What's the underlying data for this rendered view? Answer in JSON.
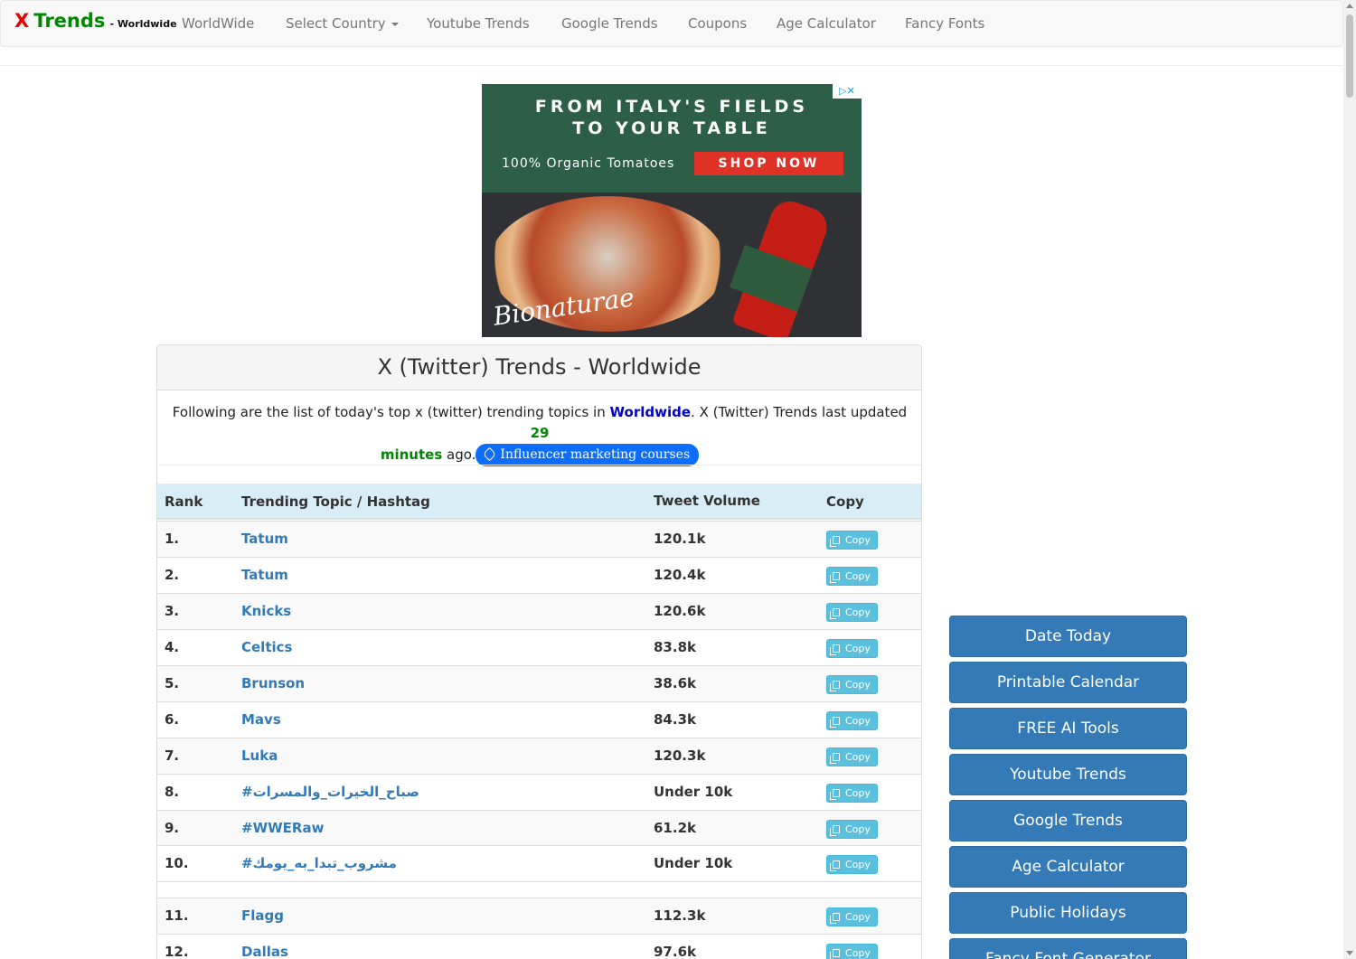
{
  "brand": {
    "x": "X",
    "trends": "Trends",
    "suffix": "- Worldwide"
  },
  "nav": {
    "worldwide": "WorldWide",
    "select_country": "Select Country",
    "youtube_trends": "Youtube Trends",
    "google_trends": "Google Trends",
    "coupons": "Coupons",
    "age_calculator": "Age Calculator",
    "fancy_fonts": "Fancy Fonts"
  },
  "ad": {
    "headline_1": "FROM ITALY'S FIELDS",
    "headline_2": "TO YOUR TABLE",
    "subline": "100% Organic Tomatoes",
    "cta": "SHOP NOW",
    "brand": "Bionaturae"
  },
  "panel": {
    "title": "X (Twitter) Trends - Worldwide",
    "intro_pre": "Following are the list of today's top x (twitter) trending topics in ",
    "intro_location": "Worldwide",
    "intro_mid": ". X (Twitter) Trends last updated ",
    "intro_minutes_num": "29",
    "intro_minutes_word": "minutes",
    "intro_post": " ago.",
    "pill_label": "Influencer marketing courses"
  },
  "table": {
    "headers": {
      "rank": "Rank",
      "topic": "Trending Topic / Hashtag",
      "volume": "Tweet Volume",
      "copy": "Copy"
    },
    "copy_label": "Copy",
    "rows": [
      {
        "rank": "1.",
        "topic": "Tatum",
        "volume": "120.1k"
      },
      {
        "rank": "2.",
        "topic": "Tatum",
        "volume": "120.4k"
      },
      {
        "rank": "3.",
        "topic": "Knicks",
        "volume": "120.6k"
      },
      {
        "rank": "4.",
        "topic": "Celtics",
        "volume": "83.8k"
      },
      {
        "rank": "5.",
        "topic": "Brunson",
        "volume": "38.6k"
      },
      {
        "rank": "6.",
        "topic": "Mavs",
        "volume": "84.3k"
      },
      {
        "rank": "7.",
        "topic": "Luka",
        "volume": "120.3k"
      },
      {
        "rank": "8.",
        "topic": "#صباح_الخيرات_والمسرات",
        "volume": "Under 10k"
      },
      {
        "rank": "9.",
        "topic": "#WWERaw",
        "volume": "61.2k"
      },
      {
        "rank": "10.",
        "topic": "#مشروب_تبدا_به_يومك",
        "volume": "Under 10k"
      },
      {
        "rank": "11.",
        "topic": "Flagg",
        "volume": "112.3k"
      },
      {
        "rank": "12.",
        "topic": "Dallas",
        "volume": "97.6k"
      }
    ]
  },
  "sidebar": {
    "date_today": "Date Today",
    "printable_calendar": "Printable Calendar",
    "free_ai_tools": "FREE AI Tools",
    "youtube_trends": "Youtube Trends",
    "google_trends": "Google Trends",
    "age_calculator": "Age Calculator",
    "public_holidays": "Public Holidays",
    "fancy_font_generator": "Fancy Font Generator"
  }
}
